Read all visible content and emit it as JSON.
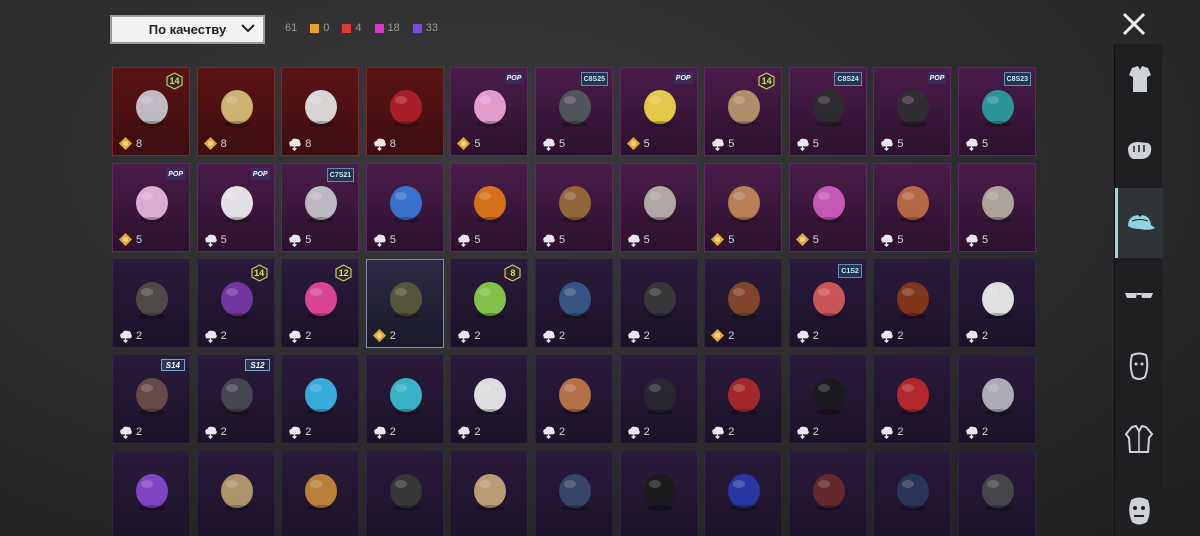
{
  "sort": {
    "label": "По качеству"
  },
  "counts": {
    "total": "61",
    "items": [
      {
        "color": "#e8a12a",
        "value": "0"
      },
      {
        "color": "#e23a3a",
        "value": "4"
      },
      {
        "color": "#d83bd0",
        "value": "18"
      },
      {
        "color": "#7b4ad8",
        "value": "33"
      }
    ]
  },
  "close_icon": "close-icon",
  "sidebar": {
    "items": [
      {
        "name": "clothing-set",
        "icon": "outfit-icon",
        "active": false
      },
      {
        "name": "hands",
        "icon": "fist-icon",
        "active": false
      },
      {
        "name": "headwear",
        "icon": "cap-icon",
        "active": true
      },
      {
        "name": "eyewear",
        "icon": "glasses-icon",
        "active": false
      },
      {
        "name": "face",
        "icon": "mask-icon",
        "active": false
      },
      {
        "name": "jacket",
        "icon": "jacket-icon",
        "active": false
      },
      {
        "name": "face-emote",
        "icon": "face-icon",
        "active": false
      }
    ]
  },
  "grid": {
    "rows": [
      [
        {
          "bg": "red",
          "label": "8",
          "curr": "gold",
          "badge": {
            "type": "num",
            "text": "14"
          },
          "item": "cat-ear-helmet"
        },
        {
          "bg": "red",
          "label": "8",
          "curr": "gold",
          "badge": null,
          "item": "golden-hair"
        },
        {
          "bg": "red",
          "label": "8",
          "curr": "silver",
          "badge": null,
          "item": "white-hat"
        },
        {
          "bg": "red",
          "label": "8",
          "curr": "silver",
          "badge": null,
          "item": "red-helmet"
        },
        {
          "bg": "pink",
          "label": "5",
          "curr": "gold",
          "badge": {
            "type": "pop",
            "text": "POP"
          },
          "item": "pink-bow-band"
        },
        {
          "bg": "pink",
          "label": "5",
          "curr": "silver",
          "badge": {
            "type": "tag",
            "text": "C8S25"
          },
          "item": "dark-hair"
        },
        {
          "bg": "pink",
          "label": "5",
          "curr": "gold",
          "badge": {
            "type": "pop",
            "text": "POP"
          },
          "item": "yellow-box-head"
        },
        {
          "bg": "pink",
          "label": "5",
          "curr": "silver",
          "badge": {
            "type": "num",
            "text": "14"
          },
          "item": "blonde-curly-hair"
        },
        {
          "bg": "pink",
          "label": "5",
          "curr": "silver",
          "badge": {
            "type": "tag",
            "text": "C8S24"
          },
          "item": "black-bob-hair"
        },
        {
          "bg": "pink",
          "label": "5",
          "curr": "silver",
          "badge": {
            "type": "pop",
            "text": "POP"
          },
          "item": "black-pigtails"
        },
        {
          "bg": "pink",
          "label": "5",
          "curr": "silver",
          "badge": {
            "type": "tag",
            "text": "C8S23"
          },
          "item": "teal-headphones"
        }
      ],
      [
        {
          "bg": "pink",
          "label": "5",
          "curr": "gold",
          "badge": {
            "type": "pop",
            "text": "POP"
          },
          "item": "pink-long-hair"
        },
        {
          "bg": "pink",
          "label": "5",
          "curr": "silver",
          "badge": {
            "type": "pop",
            "text": "POP"
          },
          "item": "panda-head"
        },
        {
          "bg": "pink",
          "label": "5",
          "curr": "silver",
          "badge": {
            "type": "tag",
            "text": "C7S21"
          },
          "item": "silver-hair"
        },
        {
          "bg": "pink",
          "label": "5",
          "curr": "silver",
          "badge": null,
          "item": "blue-dragon"
        },
        {
          "bg": "pink",
          "label": "5",
          "curr": "silver",
          "badge": null,
          "item": "pumpkin-head"
        },
        {
          "bg": "pink",
          "label": "5",
          "curr": "silver",
          "badge": null,
          "item": "brown-long-hair"
        },
        {
          "bg": "pink",
          "label": "5",
          "curr": "silver",
          "badge": null,
          "item": "grey-braids"
        },
        {
          "bg": "pink",
          "label": "5",
          "curr": "gold",
          "badge": null,
          "item": "straw-hat-pink"
        },
        {
          "bg": "pink",
          "label": "5",
          "curr": "gold",
          "badge": null,
          "item": "pink-visor-helmet"
        },
        {
          "bg": "pink",
          "label": "5",
          "curr": "silver",
          "badge": null,
          "item": "antler-hat"
        },
        {
          "bg": "pink",
          "label": "5",
          "curr": "silver",
          "badge": null,
          "item": "dreadlocks"
        }
      ],
      [
        {
          "bg": "purple",
          "label": "2",
          "curr": "silver",
          "badge": null,
          "item": "masked-head"
        },
        {
          "bg": "purple",
          "label": "2",
          "curr": "silver",
          "badge": {
            "type": "num",
            "text": "14"
          },
          "item": "purple-bow-hair"
        },
        {
          "bg": "purple",
          "label": "2",
          "curr": "silver",
          "badge": {
            "type": "num",
            "text": "12"
          },
          "item": "bunny-ears"
        },
        {
          "bg": "gold",
          "label": "2",
          "curr": "gold",
          "badge": null,
          "item": "officer-cap"
        },
        {
          "bg": "purple",
          "label": "2",
          "curr": "silver",
          "badge": {
            "type": "num",
            "text": "8"
          },
          "item": "green-skull-hood"
        },
        {
          "bg": "purple",
          "label": "2",
          "curr": "silver",
          "badge": null,
          "item": "blue-cap"
        },
        {
          "bg": "purple",
          "label": "2",
          "curr": "silver",
          "badge": null,
          "item": "gas-mask"
        },
        {
          "bg": "purple",
          "label": "2",
          "curr": "gold",
          "badge": null,
          "item": "aviator-helmet"
        },
        {
          "bg": "purple",
          "label": "2",
          "curr": "silver",
          "badge": {
            "type": "tag",
            "text": "C1S2"
          },
          "item": "bandana"
        },
        {
          "bg": "purple",
          "label": "2",
          "curr": "silver",
          "badge": null,
          "item": "tribal-mask"
        },
        {
          "bg": "purple",
          "label": "2",
          "curr": "silver",
          "badge": null,
          "item": "cake-hat"
        }
      ],
      [
        {
          "bg": "purple",
          "label": "2",
          "curr": "silver",
          "badge": {
            "type": "season",
            "text": "S14"
          },
          "item": "knight-helmet"
        },
        {
          "bg": "purple",
          "label": "2",
          "curr": "silver",
          "badge": {
            "type": "season",
            "text": "S12"
          },
          "item": "tactical-helmet"
        },
        {
          "bg": "purple",
          "label": "2",
          "curr": "silver",
          "badge": null,
          "item": "blue-bunny-band"
        },
        {
          "bg": "purple",
          "label": "2",
          "curr": "silver",
          "badge": null,
          "item": "teal-hair"
        },
        {
          "bg": "purple",
          "label": "2",
          "curr": "silver",
          "badge": null,
          "item": "white-visor"
        },
        {
          "bg": "purple",
          "label": "2",
          "curr": "silver",
          "badge": null,
          "item": "rice-hat"
        },
        {
          "bg": "purple",
          "label": "2",
          "curr": "silver",
          "badge": null,
          "item": "black-balaclava"
        },
        {
          "bg": "purple",
          "label": "2",
          "curr": "silver",
          "badge": null,
          "item": "red-beret"
        },
        {
          "bg": "purple",
          "label": "2",
          "curr": "silver",
          "badge": null,
          "item": "top-hat"
        },
        {
          "bg": "purple",
          "label": "2",
          "curr": "silver",
          "badge": null,
          "item": "red-fedora"
        },
        {
          "bg": "purple",
          "label": "2",
          "curr": "silver",
          "badge": null,
          "item": "shark-hat"
        }
      ],
      [
        {
          "bg": "purple",
          "label": "",
          "curr": "",
          "badge": null,
          "item": "flower-crown"
        },
        {
          "bg": "purple",
          "label": "",
          "curr": "",
          "badge": null,
          "item": "knit-hat"
        },
        {
          "bg": "purple",
          "label": "",
          "curr": "",
          "badge": null,
          "item": "burger-hat"
        },
        {
          "bg": "purple",
          "label": "",
          "curr": "",
          "badge": null,
          "item": "headlamp"
        },
        {
          "bg": "purple",
          "label": "",
          "curr": "",
          "badge": null,
          "item": "paper-bag"
        },
        {
          "bg": "purple",
          "label": "",
          "curr": "",
          "badge": null,
          "item": "navy-cap"
        },
        {
          "bg": "purple",
          "label": "",
          "curr": "",
          "badge": null,
          "item": "black-cap"
        },
        {
          "bg": "purple",
          "label": "",
          "curr": "",
          "badge": null,
          "item": "blue-cap-2"
        },
        {
          "bg": "purple",
          "label": "",
          "curr": "",
          "badge": null,
          "item": "brown-hat"
        },
        {
          "bg": "purple",
          "label": "",
          "curr": "",
          "badge": null,
          "item": "bucket-hat"
        },
        {
          "bg": "purple",
          "label": "",
          "curr": "",
          "badge": null,
          "item": "pilot-cap"
        }
      ]
    ]
  },
  "item_colors": {
    "cat-ear-helmet": "#c9c9d2",
    "golden-hair": "#d8c07a",
    "white-hat": "#e6e6e6",
    "red-helmet": "#b0202a",
    "pink-bow-band": "#f0a8d8",
    "dark-hair": "#555a5f",
    "yellow-box-head": "#f2d84a",
    "blonde-curly-hair": "#b89a6a",
    "black-bob-hair": "#2c2c2e",
    "black-pigtails": "#303033",
    "teal-headphones": "#2aa0a0",
    "pink-long-hair": "#e8bce0",
    "panda-head": "#f2f2f2",
    "silver-hair": "#c8c8cc",
    "blue-dragon": "#3a7ad8",
    "pumpkin-head": "#e07a18",
    "brown-long-hair": "#9a6e3a",
    "grey-braids": "#b8b4ae",
    "straw-hat-pink": "#c48a5a",
    "pink-visor-helmet": "#d060c0",
    "antler-hat": "#c07048",
    "dreadlocks": "#b8b0a0",
    "masked-head": "#55504a",
    "purple-bow-hair": "#7a3aa8",
    "bunny-ears": "#e84a9a",
    "officer-cap": "#5a5a3a",
    "green-skull-hood": "#8ad04a",
    "blue-cap": "#3a5a8a",
    "gas-mask": "#3a3a3a",
    "aviator-helmet": "#8a4a2a",
    "bandana": "#d85a5a",
    "tribal-mask": "#8a3a1a",
    "cake-hat": "#f0f0f0",
    "knight-helmet": "#6a5048",
    "tactical-helmet": "#4a4a55",
    "blue-bunny-band": "#3ab8e8",
    "teal-hair": "#3ac0d0",
    "white-visor": "#eeeeee",
    "rice-hat": "#c07a4a",
    "black-balaclava": "#2a2a30",
    "red-beret": "#b02a2a",
    "top-hat": "#1a1a1c",
    "red-fedora": "#c02a2a",
    "shark-hat": "#b8b8c0",
    "flower-crown": "#8a4ad0",
    "knit-hat": "#b8a070",
    "burger-hat": "#c88a3a",
    "headlamp": "#3a3a3a",
    "paper-bag": "#c8a87a",
    "navy-cap": "#3a4a6a",
    "black-cap": "#1a1a1a",
    "blue-cap-2": "#2a3aa8",
    "brown-hat": "#6a2a2a",
    "bucket-hat": "#2a3a5a",
    "pilot-cap": "#4a4a4e"
  }
}
